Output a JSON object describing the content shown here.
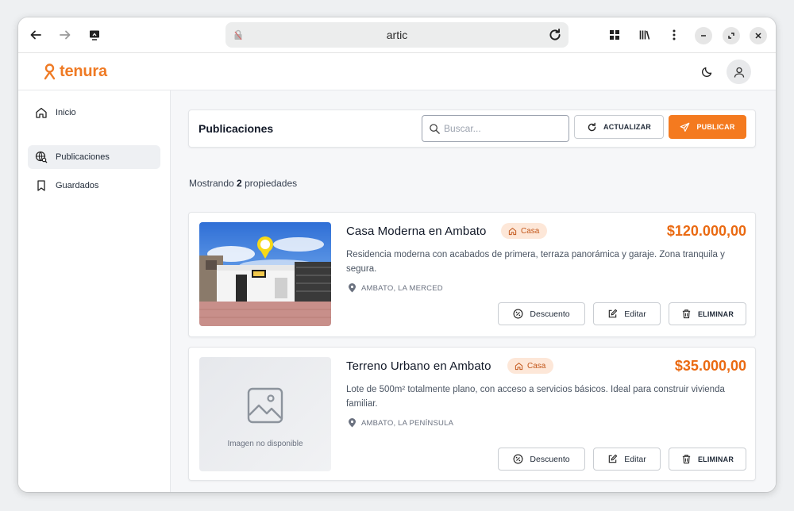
{
  "browser": {
    "url": "artic"
  },
  "app": {
    "brand": "tenura",
    "brand_color": "#ef7a24"
  },
  "sidebar": {
    "items": [
      {
        "label": "Inicio",
        "icon": "home-icon",
        "active": false
      },
      {
        "label": "Publicaciones",
        "icon": "globe-search-icon",
        "active": true
      },
      {
        "label": "Guardados",
        "icon": "bookmark-icon",
        "active": false
      }
    ]
  },
  "toolbar": {
    "title": "Publicaciones",
    "search_placeholder": "Buscar...",
    "refresh_label": "ACTUALIZAR",
    "publish_label": "PUBLICAR"
  },
  "summary": {
    "prefix": "Mostrando",
    "count": "2",
    "suffix": "propiedades"
  },
  "listings": [
    {
      "title": "Casa Moderna en Ambato",
      "type": "Casa",
      "price": "$120.000,00",
      "description": "Residencia moderna con acabados de primera, terraza panorámica y garaje. Zona tranquila y segura.",
      "location": "AMBATO, LA MERCED",
      "image": "house-photo",
      "actions": {
        "discount": "Descuento",
        "edit": "Editar",
        "delete": "ELIMINAR"
      }
    },
    {
      "title": "Terreno Urbano en Ambato",
      "type": "Casa",
      "price": "$35.000,00",
      "description": "Lote de 500m² totalmente plano, con acceso a servicios básicos. Ideal para construir vivienda familiar.",
      "location": "AMBATO, LA PENÍNSULA",
      "image_placeholder": "Imagen no disponible",
      "actions": {
        "discount": "Descuento",
        "edit": "Editar",
        "delete": "ELIMINAR"
      }
    }
  ],
  "colors": {
    "accent": "#f47a1f",
    "price": "#ea6a12",
    "badge_bg": "#fde7d8",
    "badge_text": "#c2571b"
  }
}
